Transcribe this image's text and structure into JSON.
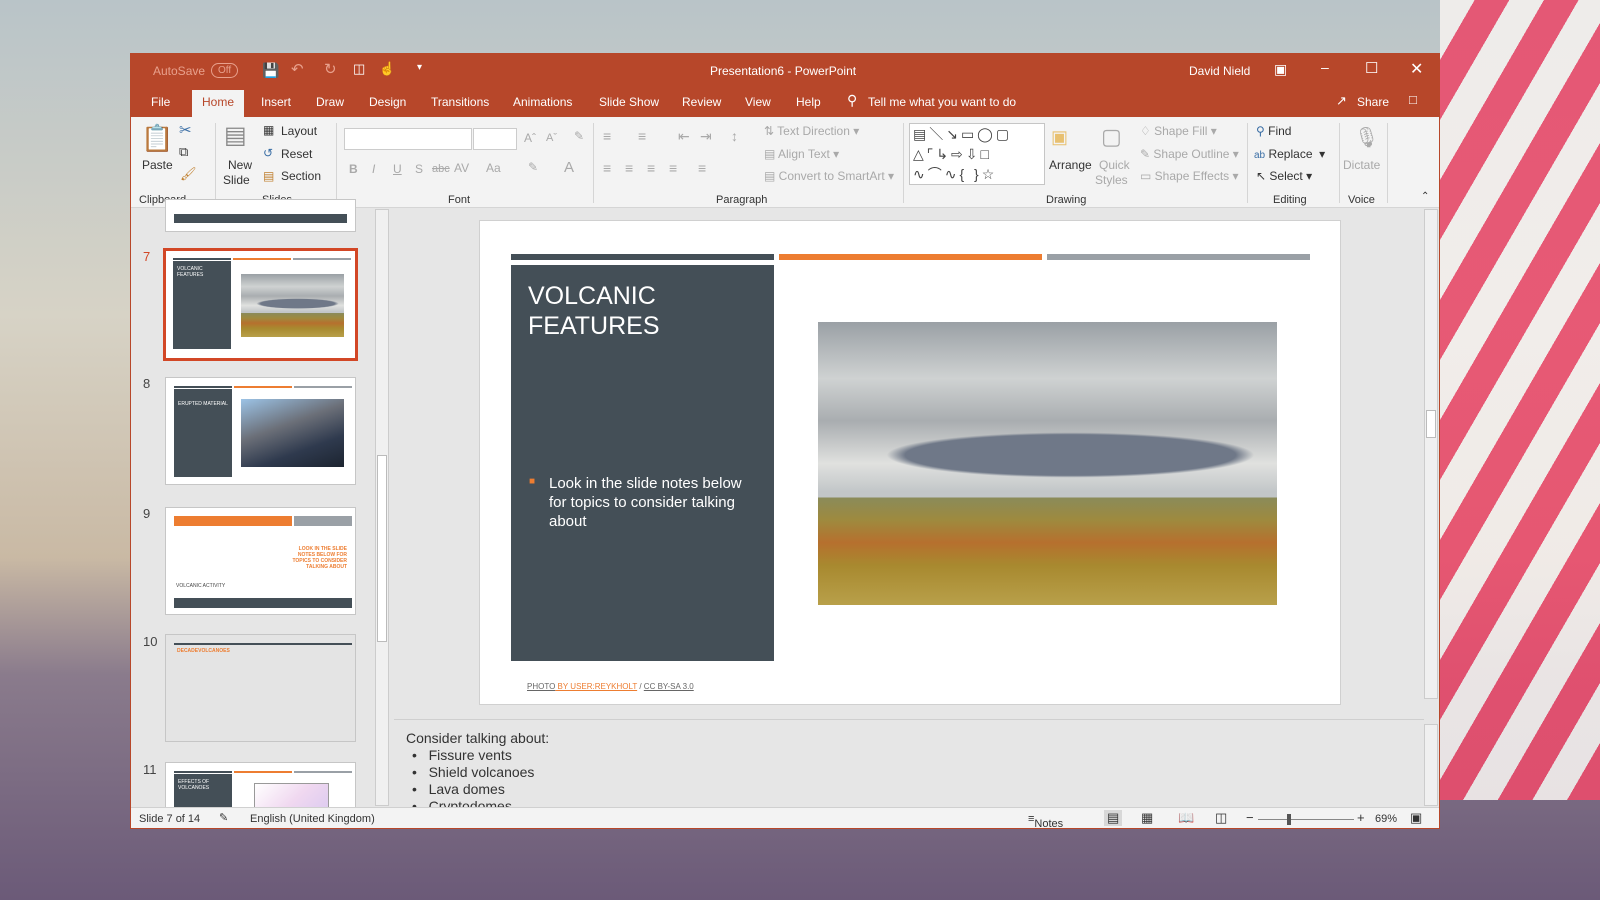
{
  "titlebar": {
    "autosave": "AutoSave",
    "autosave_state": "Off",
    "title": "Presentation6  -  PowerPoint",
    "user": "David Nield"
  },
  "tabs": [
    "File",
    "Home",
    "Insert",
    "Draw",
    "Design",
    "Transitions",
    "Animations",
    "Slide Show",
    "Review",
    "View",
    "Help"
  ],
  "tell_me": "Tell me what you want to do",
  "share": "Share",
  "ribbon": {
    "clipboard": {
      "paste": "Paste",
      "label": "Clipboard"
    },
    "slides": {
      "new_slide": "New",
      "new_slide2": "Slide",
      "layout": "Layout",
      "reset": "Reset",
      "section": "Section",
      "label": "Slides"
    },
    "font": {
      "bold": "B",
      "italic": "I",
      "underline": "U",
      "shadow": "S",
      "strike": "abc",
      "spacing": "AV",
      "case": "Aa",
      "label": "Font"
    },
    "paragraph": {
      "text_direction": "Text Direction",
      "align_text": "Align Text",
      "smartart": "Convert to SmartArt",
      "label": "Paragraph"
    },
    "drawing": {
      "arrange": "Arrange",
      "quick_styles": "Quick",
      "quick_styles2": "Styles",
      "shape_fill": "Shape Fill",
      "shape_outline": "Shape Outline",
      "shape_effects": "Shape Effects",
      "label": "Drawing"
    },
    "editing": {
      "find": "Find",
      "replace": "Replace",
      "select": "Select",
      "label": "Editing"
    },
    "voice": {
      "dictate": "Dictate",
      "label": "Voice"
    }
  },
  "thumbnails": [
    {
      "num": "7",
      "title": "VOLCANIC FEATURES",
      "selected": true
    },
    {
      "num": "8",
      "title": "ERUPTED MATERIAL"
    },
    {
      "num": "9",
      "title": "VOLCANIC ACTIVITY",
      "side": "LOOK IN THE SLIDE NOTES BELOW FOR TOPICS TO CONSIDER TALKING ABOUT"
    },
    {
      "num": "10",
      "title": "DECADEVOLCANOES"
    },
    {
      "num": "11",
      "title": "EFFECTS OF VOLCANOES"
    }
  ],
  "slide": {
    "title_line1": "VOLCANIC",
    "title_line2": "FEATURES",
    "bullet": "Look in the slide notes below for topics to consider talking about",
    "caption_photo": "PHOTO",
    "caption_by": " BY USER:REYKHOLT",
    "caption_sep": " / ",
    "caption_license": "CC BY-SA 3.0"
  },
  "notes": {
    "intro": "Consider talking about:",
    "items": [
      "Fissure vents",
      "Shield volcanoes",
      "Lava domes",
      "Cryptodomes"
    ]
  },
  "status": {
    "slide": "Slide 7 of 14",
    "language": "English (United Kingdom)",
    "notes": "Notes",
    "zoom": "69%",
    "zoom_percent": 69
  },
  "colors": {
    "accent": "#B7472A",
    "slide_dark": "#444F57",
    "slide_orange": "#ED7D31",
    "slide_gray": "#9AA0A6"
  }
}
